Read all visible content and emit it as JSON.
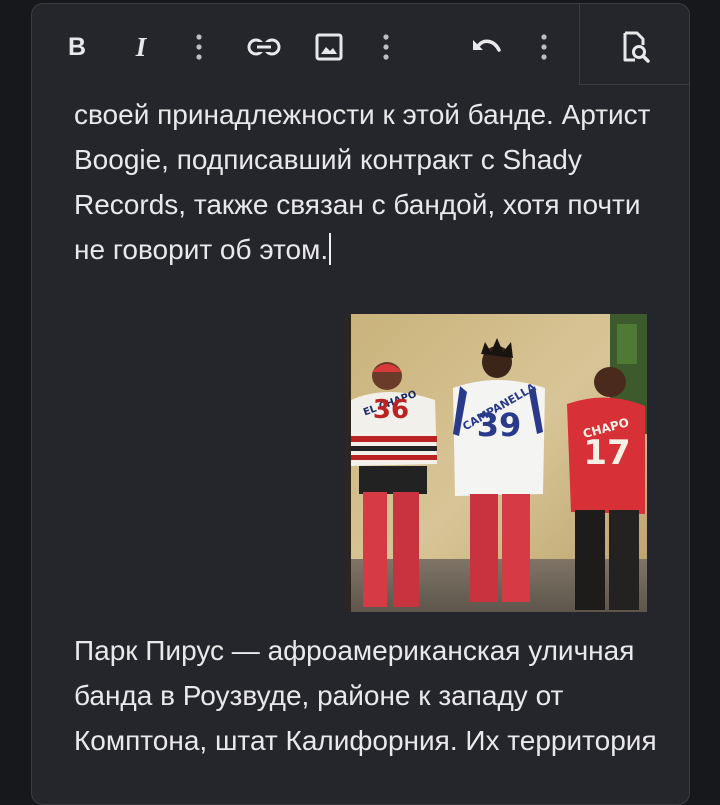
{
  "toolbar": {
    "bold_label": "B",
    "italic_label": "I",
    "buttons": [
      {
        "icon": "bold-icon"
      },
      {
        "icon": "italic-icon"
      },
      {
        "icon": "more-vertical-icon"
      },
      {
        "icon": "link-icon"
      },
      {
        "icon": "image-icon"
      },
      {
        "icon": "more-vertical-icon"
      },
      {
        "icon": "undo-icon"
      },
      {
        "icon": "more-vertical-icon"
      },
      {
        "icon": "preview-search-icon"
      }
    ]
  },
  "content": {
    "paragraph1": "своей принадлежности к этой банде. Артист Boogie, подписавший контракт с Shady Records, также связан с бандой, хотя почти не говорит об этом.",
    "image": {
      "jerseys": [
        {
          "name": "EL CHAPO",
          "number": "36"
        },
        {
          "name": "CAMPANELLA",
          "number": "39"
        },
        {
          "name": "CHAPO",
          "number": "17"
        }
      ]
    },
    "paragraph2": " Парк Пирус — афроамериканская уличная банда в Роузвуде, районе к западу от Комптона, штат Калифорния. Их территория"
  },
  "colors": {
    "background": "#17181c",
    "editor_bg": "#25262b",
    "text": "#e9e9ec",
    "border": "#3a3c42"
  }
}
